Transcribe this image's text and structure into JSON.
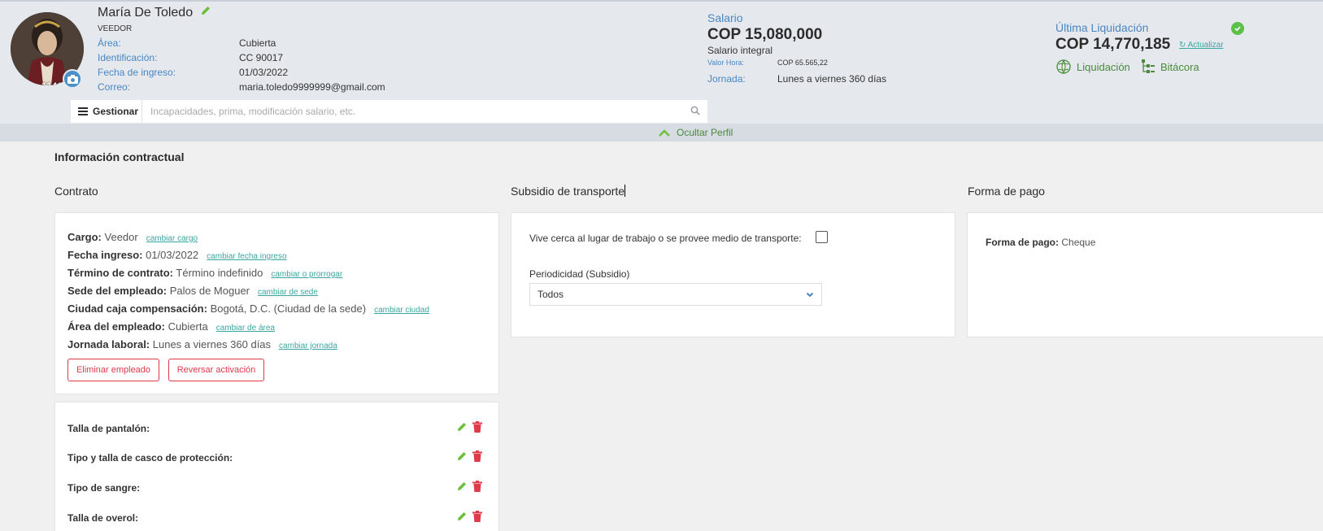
{
  "profile": {
    "name": "María De Toledo",
    "role": "VEEDOR",
    "employee_id": "11414",
    "fields": [
      {
        "label": "Área:",
        "value": "Cubierta"
      },
      {
        "label": "Identificación:",
        "value": "CC 90017"
      },
      {
        "label": "Fecha de ingreso:",
        "value": "01/03/2022"
      },
      {
        "label": "Correo:",
        "value": "maria.toledo9999999@gmail.com"
      }
    ]
  },
  "salary": {
    "label": "Salario",
    "amount": "COP 15,080,000",
    "type": "Salario integral",
    "rows": [
      {
        "label": "Valor Hora:",
        "value": "COP 65.565,22"
      },
      {
        "label": "Jornada:",
        "value": "Lunes a viernes 360 días"
      }
    ]
  },
  "liquidation": {
    "label": "Última Liquidación",
    "amount": "COP 14,770,185",
    "refresh_label": "Actualizar",
    "liquidacion_label": "Liquidación",
    "bitacora_label": "Bitácora"
  },
  "gestionar": {
    "button_label": "Gestionar",
    "placeholder": "Incapacidades, prima, modificación salario, etc."
  },
  "toggle": {
    "label": "Ocultar Perfil"
  },
  "main": {
    "title": "Información contractual",
    "contrato": {
      "title": "Contrato",
      "rows": [
        {
          "label": "Cargo:",
          "value": "Veedor",
          "link": "cambiar cargo"
        },
        {
          "label": "Fecha ingreso:",
          "value": "01/03/2022",
          "link": "cambiar fecha ingreso"
        },
        {
          "label": "Término de contrato:",
          "value": "Término indefinido",
          "link": "cambiar o prorrogar"
        },
        {
          "label": "Sede del empleado:",
          "value": "Palos de Moguer",
          "link": "cambiar de sede"
        },
        {
          "label": "Ciudad caja compensación:",
          "value": "Bogotá, D.C. (Ciudad de la sede)",
          "link": "cambiar ciudad"
        },
        {
          "label": "Área del empleado:",
          "value": "Cubierta",
          "link": "cambiar de área"
        },
        {
          "label": "Jornada laboral:",
          "value": "Lunes a viernes 360 días",
          "link": "cambiar jornada"
        }
      ],
      "delete_button": "Eliminar empleado",
      "reverse_button": "Reversar activación"
    },
    "attributes": [
      {
        "label": "Talla de pantalón:"
      },
      {
        "label": "Tipo y talla de casco de protección:"
      },
      {
        "label": "Tipo de sangre:"
      },
      {
        "label": "Talla de overol:"
      }
    ],
    "subsidio": {
      "title": "Subsidio de transporte",
      "checkbox_label": "Vive cerca al lugar de trabajo o se provee medio de transporte:",
      "periodicidad_label": "Periodicidad (Subsidio)",
      "periodicidad_value": "Todos"
    },
    "forma_pago": {
      "title": "Forma de pago",
      "label": "Forma de pago:",
      "value": "Cheque"
    }
  },
  "colors": {
    "accent_blue": "#4a86c0",
    "link_teal": "#3aa6a0",
    "green": "#4a8a3a",
    "danger": "#e0394a"
  }
}
